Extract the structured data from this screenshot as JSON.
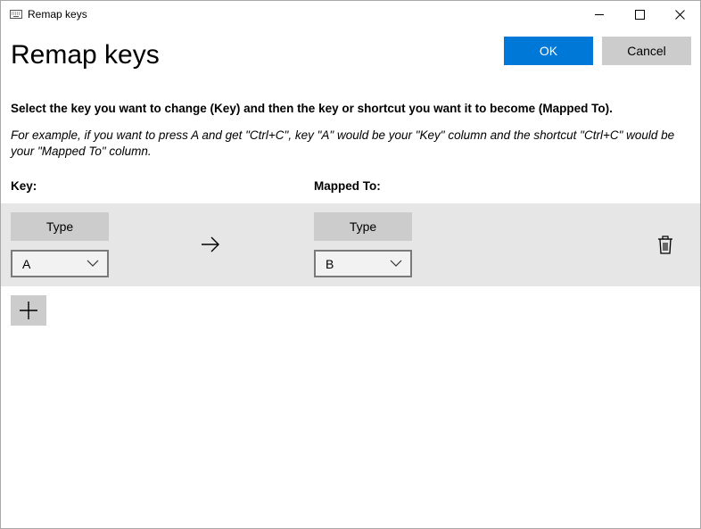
{
  "window": {
    "title": "Remap keys",
    "icon": "keyboard-icon",
    "controls": [
      "minimize-icon",
      "maximize-icon",
      "close-icon"
    ]
  },
  "header": {
    "title": "Remap keys",
    "ok_label": "OK",
    "cancel_label": "Cancel"
  },
  "instructions": {
    "main": "Select the key you want to change (Key) and then the key or shortcut you want it to become (Mapped To).",
    "example": "For example, if you want to press A and get \"Ctrl+C\", key \"A\" would be your \"Key\" column and the shortcut \"Ctrl+C\" would be your \"Mapped To\" column."
  },
  "columns": {
    "key_header": "Key:",
    "mapped_header": "Mapped To:"
  },
  "mappings": [
    {
      "key_type_label": "Type",
      "key_value": "A",
      "mapped_type_label": "Type",
      "mapped_value": "B"
    }
  ],
  "colors": {
    "accent": "#0078d7",
    "button_gray": "#cccccc",
    "row_background": "#e6e6e6"
  }
}
